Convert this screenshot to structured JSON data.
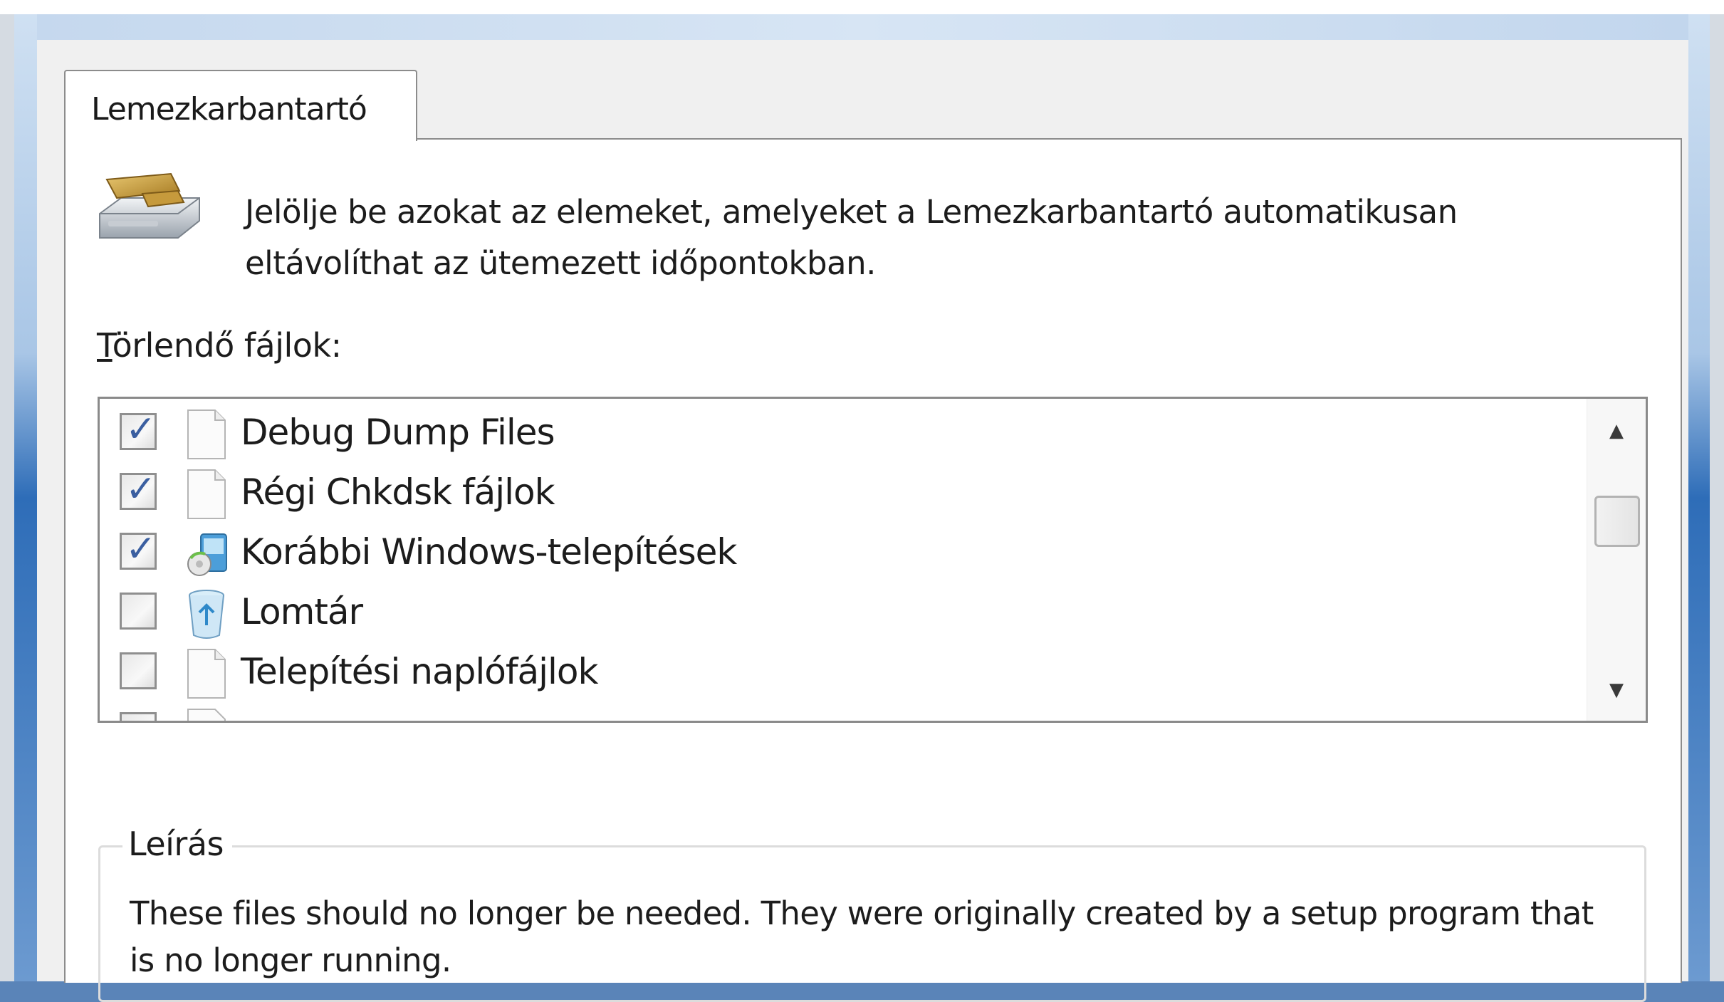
{
  "tab": {
    "label": "Lemezkarbantartó"
  },
  "intro": {
    "line1": "Jelölje be azokat az elemeket, amelyeket a Lemezkarbantartó automatikusan",
    "line2": "eltávolíthat az ütemezett időpontokban."
  },
  "files": {
    "label_underlined": "T",
    "label_rest": "örlendő fájlok:",
    "items": [
      {
        "label": "Debug Dump Files",
        "checked": true,
        "icon": "blank-file-icon"
      },
      {
        "label": "Régi Chkdsk fájlok",
        "checked": true,
        "icon": "blank-file-icon"
      },
      {
        "label": "Korábbi Windows-telepítések",
        "checked": true,
        "icon": "windows-setup-icon"
      },
      {
        "label": "Lomtár",
        "checked": false,
        "icon": "recycle-bin-icon"
      },
      {
        "label": "Telepítési naplófájlok",
        "checked": false,
        "icon": "blank-file-icon"
      }
    ]
  },
  "description": {
    "title": "Leírás",
    "text": "These files should no longer be needed. They were originally created by a setup program that is no longer running."
  },
  "scrollbar": {
    "up_glyph": "▲",
    "down_glyph": "▼"
  },
  "colors": {
    "accent": "#3b5fa0",
    "frame_blue": "#2e6db8"
  }
}
